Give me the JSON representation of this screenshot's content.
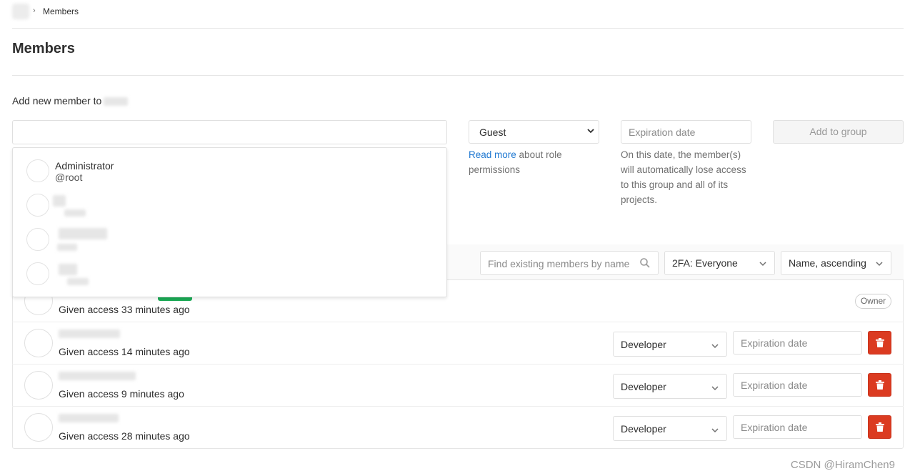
{
  "breadcrumb": {
    "separator": "›",
    "current": "Members"
  },
  "page": {
    "title": "Members"
  },
  "add_form": {
    "label": "Add new member to",
    "search_placeholder": "",
    "role_selected": "Guest",
    "expiration_placeholder": "Expiration date",
    "add_button": "Add to group",
    "role_help_link": "Read more",
    "role_help_rest": " about role permissions",
    "expiration_help": "On this date, the member(s) will automatically lose access to this group and all of its projects."
  },
  "autocomplete": {
    "items": [
      {
        "name": "Administrator",
        "username": "@root"
      }
    ]
  },
  "members_list": {
    "search_placeholder": "Find existing members by name",
    "filter_2fa": "2FA: Everyone",
    "sort": "Name, ascending",
    "rows": [
      {
        "access": "Given access 33 minutes ago",
        "badge": "Owner"
      },
      {
        "access": "Given access 14 minutes ago",
        "role": "Developer",
        "expiration_placeholder": "Expiration date"
      },
      {
        "access": "Given access 9 minutes ago",
        "role": "Developer",
        "expiration_placeholder": "Expiration date"
      },
      {
        "access": "Given access 28 minutes ago",
        "role": "Developer",
        "expiration_placeholder": "Expiration date"
      }
    ]
  },
  "watermark": "CSDN @HiramChen9",
  "colors": {
    "link": "#1f78d1",
    "danger": "#db3b21",
    "success": "#1aaa55"
  }
}
